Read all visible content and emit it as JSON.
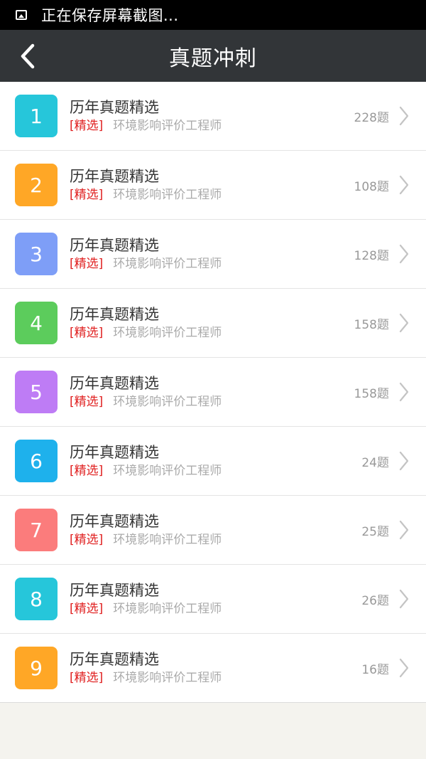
{
  "status_bar": {
    "text": "正在保存屏幕截图..."
  },
  "header": {
    "title": "真题冲刺"
  },
  "items": [
    {
      "num": "1",
      "title": "历年真题精选",
      "tag": "[精选]",
      "subtitle": "环境影响评价工程师",
      "count": "228题",
      "color": "#26c6da"
    },
    {
      "num": "2",
      "title": "历年真题精选",
      "tag": "[精选]",
      "subtitle": "环境影响评价工程师",
      "count": "108题",
      "color": "#ffa726"
    },
    {
      "num": "3",
      "title": "历年真题精选",
      "tag": "[精选]",
      "subtitle": "环境影响评价工程师",
      "count": "128题",
      "color": "#7e9ef7"
    },
    {
      "num": "4",
      "title": "历年真题精选",
      "tag": "[精选]",
      "subtitle": "环境影响评价工程师",
      "count": "158题",
      "color": "#5ccc5c"
    },
    {
      "num": "5",
      "title": "历年真题精选",
      "tag": "[精选]",
      "subtitle": "环境影响评价工程师",
      "count": "158题",
      "color": "#be7cf5"
    },
    {
      "num": "6",
      "title": "历年真题精选",
      "tag": "[精选]",
      "subtitle": "环境影响评价工程师",
      "count": "24题",
      "color": "#1eb1ec"
    },
    {
      "num": "7",
      "title": "历年真题精选",
      "tag": "[精选]",
      "subtitle": "环境影响评价工程师",
      "count": "25题",
      "color": "#fb7c7c"
    },
    {
      "num": "8",
      "title": "历年真题精选",
      "tag": "[精选]",
      "subtitle": "环境影响评价工程师",
      "count": "26题",
      "color": "#26c6da"
    },
    {
      "num": "9",
      "title": "历年真题精选",
      "tag": "[精选]",
      "subtitle": "环境影响评价工程师",
      "count": "16题",
      "color": "#ffa726"
    }
  ],
  "icons": {
    "status": "image-icon",
    "back": "chevron-left-icon",
    "row": "chevron-right-icon"
  }
}
